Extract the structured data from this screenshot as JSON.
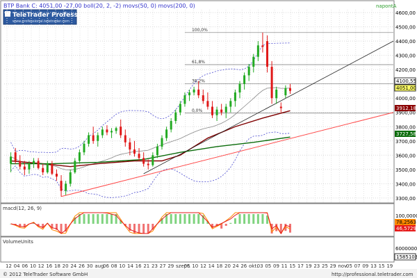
{
  "header": {
    "title": "BTP Bank C: 4051,00 -27,00 boll(20, 2, -2) movs(50, 0) movs(200, 0)",
    "period": "napontA",
    "logo_text": "TeleTrader Professional",
    "logo_url": "www.professional.teletrader.com"
  },
  "price_tags": {
    "last_price_box": "4100,55",
    "last_price": "4051,00",
    "ma50": "3912,18",
    "ma200": "3727,58"
  },
  "fib_labels": [
    "100,0%",
    "61,8%",
    "38,2%",
    "0,0%"
  ],
  "macd": {
    "title": "macd(12, 26, 9)",
    "value_1": "78,2563",
    "value_2": "46,5729",
    "scale_label": "100,0000"
  },
  "volume": {
    "title": "VolumeUnits",
    "scale_label": "6000000",
    "last_value": "1585103"
  },
  "footer": {
    "copyright": "© 2012 TeleTrader Software GmbH",
    "url": "http://professional.teletrader.com"
  },
  "chart_data": {
    "type": "candlestick",
    "y_ticks": [
      "4600,00",
      "4500,00",
      "4400,00",
      "4300,00",
      "4200,00",
      "4100,00",
      "4000,00",
      "3900,00",
      "3800,00",
      "3700,00",
      "3600,00",
      "3500,00",
      "3400,00",
      "3300,00"
    ],
    "ylim": [
      3270,
      4620
    ],
    "x_ticks": [
      "12",
      "04",
      "06",
      "10",
      "12",
      "16",
      "18",
      "20",
      "24",
      "26",
      "30",
      "aug.",
      "06",
      "08",
      "10",
      "14",
      "16",
      "21",
      "23",
      "27",
      "29",
      "szept.",
      "06",
      "10",
      "12",
      "14",
      "18",
      "20",
      "24",
      "26",
      "okt.",
      "03",
      "05",
      "09",
      "11",
      "15",
      "17",
      "19",
      "23",
      "25",
      "29",
      "nov.",
      "05",
      "07",
      "09",
      "13",
      "15",
      "19"
    ],
    "candles": [
      {
        "x": 1,
        "o": 3540,
        "h": 3620,
        "l": 3480,
        "c": 3590
      },
      {
        "x": 2,
        "o": 3620,
        "h": 3650,
        "l": 3540,
        "c": 3560
      },
      {
        "x": 3,
        "o": 3560,
        "h": 3600,
        "l": 3500,
        "c": 3520
      },
      {
        "x": 4,
        "o": 3520,
        "h": 3560,
        "l": 3460,
        "c": 3500
      },
      {
        "x": 5,
        "o": 3500,
        "h": 3560,
        "l": 3470,
        "c": 3540
      },
      {
        "x": 6,
        "o": 3540,
        "h": 3580,
        "l": 3510,
        "c": 3560
      },
      {
        "x": 7,
        "o": 3560,
        "h": 3580,
        "l": 3500,
        "c": 3510
      },
      {
        "x": 8,
        "o": 3510,
        "h": 3540,
        "l": 3460,
        "c": 3480
      },
      {
        "x": 9,
        "o": 3480,
        "h": 3560,
        "l": 3470,
        "c": 3540
      },
      {
        "x": 10,
        "o": 3540,
        "h": 3560,
        "l": 3460,
        "c": 3470
      },
      {
        "x": 11,
        "o": 3470,
        "h": 3500,
        "l": 3420,
        "c": 3450
      },
      {
        "x": 12,
        "o": 3420,
        "h": 3460,
        "l": 3310,
        "c": 3350
      },
      {
        "x": 13,
        "o": 3350,
        "h": 3420,
        "l": 3320,
        "c": 3400
      },
      {
        "x": 14,
        "o": 3400,
        "h": 3500,
        "l": 3380,
        "c": 3480
      },
      {
        "x": 15,
        "o": 3480,
        "h": 3580,
        "l": 3470,
        "c": 3560
      },
      {
        "x": 16,
        "o": 3560,
        "h": 3640,
        "l": 3540,
        "c": 3620
      },
      {
        "x": 17,
        "o": 3620,
        "h": 3700,
        "l": 3600,
        "c": 3680
      },
      {
        "x": 18,
        "o": 3680,
        "h": 3760,
        "l": 3660,
        "c": 3740
      },
      {
        "x": 19,
        "o": 3740,
        "h": 3800,
        "l": 3680,
        "c": 3700
      },
      {
        "x": 20,
        "o": 3700,
        "h": 3760,
        "l": 3660,
        "c": 3740
      },
      {
        "x": 21,
        "o": 3740,
        "h": 3800,
        "l": 3720,
        "c": 3780
      },
      {
        "x": 22,
        "o": 3780,
        "h": 3810,
        "l": 3740,
        "c": 3760
      },
      {
        "x": 23,
        "o": 3760,
        "h": 3790,
        "l": 3720,
        "c": 3770
      },
      {
        "x": 24,
        "o": 3770,
        "h": 3800,
        "l": 3750,
        "c": 3790
      },
      {
        "x": 25,
        "o": 3800,
        "h": 3850,
        "l": 3720,
        "c": 3740
      },
      {
        "x": 26,
        "o": 3740,
        "h": 3780,
        "l": 3660,
        "c": 3690
      },
      {
        "x": 27,
        "o": 3690,
        "h": 3720,
        "l": 3600,
        "c": 3640
      },
      {
        "x": 28,
        "o": 3640,
        "h": 3700,
        "l": 3590,
        "c": 3610
      },
      {
        "x": 29,
        "o": 3610,
        "h": 3650,
        "l": 3560,
        "c": 3580
      },
      {
        "x": 30,
        "o": 3580,
        "h": 3620,
        "l": 3520,
        "c": 3540
      },
      {
        "x": 31,
        "o": 3540,
        "h": 3570,
        "l": 3500,
        "c": 3530
      },
      {
        "x": 32,
        "o": 3530,
        "h": 3620,
        "l": 3520,
        "c": 3600
      },
      {
        "x": 33,
        "o": 3600,
        "h": 3680,
        "l": 3580,
        "c": 3660
      },
      {
        "x": 34,
        "o": 3660,
        "h": 3740,
        "l": 3640,
        "c": 3720
      },
      {
        "x": 35,
        "o": 3720,
        "h": 3800,
        "l": 3700,
        "c": 3780
      },
      {
        "x": 36,
        "o": 3780,
        "h": 3860,
        "l": 3760,
        "c": 3840
      },
      {
        "x": 37,
        "o": 3840,
        "h": 3920,
        "l": 3820,
        "c": 3900
      },
      {
        "x": 38,
        "o": 3900,
        "h": 3980,
        "l": 3880,
        "c": 3960
      },
      {
        "x": 39,
        "o": 3960,
        "h": 4040,
        "l": 3940,
        "c": 4020
      },
      {
        "x": 40,
        "o": 4020,
        "h": 4060,
        "l": 3980,
        "c": 4040
      },
      {
        "x": 41,
        "o": 4040,
        "h": 4080,
        "l": 4020,
        "c": 4060
      },
      {
        "x": 42,
        "o": 4060,
        "h": 4120,
        "l": 4000,
        "c": 4020
      },
      {
        "x": 43,
        "o": 4020,
        "h": 4060,
        "l": 3960,
        "c": 3980
      },
      {
        "x": 44,
        "o": 3980,
        "h": 4040,
        "l": 3920,
        "c": 3940
      },
      {
        "x": 45,
        "o": 3940,
        "h": 3980,
        "l": 3860,
        "c": 3880
      },
      {
        "x": 46,
        "o": 3880,
        "h": 3940,
        "l": 3840,
        "c": 3920
      },
      {
        "x": 47,
        "o": 3920,
        "h": 3960,
        "l": 3880,
        "c": 3900
      },
      {
        "x": 48,
        "o": 3900,
        "h": 3960,
        "l": 3860,
        "c": 3940
      },
      {
        "x": 49,
        "o": 3940,
        "h": 4000,
        "l": 3900,
        "c": 3980
      },
      {
        "x": 50,
        "o": 3980,
        "h": 4060,
        "l": 3940,
        "c": 4040
      },
      {
        "x": 51,
        "o": 4040,
        "h": 4120,
        "l": 4000,
        "c": 4100
      },
      {
        "x": 52,
        "o": 4100,
        "h": 4180,
        "l": 4060,
        "c": 4160
      },
      {
        "x": 53,
        "o": 4160,
        "h": 4240,
        "l": 4120,
        "c": 4220
      },
      {
        "x": 54,
        "o": 4220,
        "h": 4310,
        "l": 4180,
        "c": 4290
      },
      {
        "x": 55,
        "o": 4290,
        "h": 4400,
        "l": 4260,
        "c": 4370
      },
      {
        "x": 56,
        "o": 4370,
        "h": 4460,
        "l": 4320,
        "c": 4360
      },
      {
        "x": 57,
        "o": 4400,
        "h": 4440,
        "l": 4180,
        "c": 4220
      },
      {
        "x": 58,
        "o": 4220,
        "h": 4260,
        "l": 3960,
        "c": 4000
      },
      {
        "x": 59,
        "o": 4000,
        "h": 4080,
        "l": 3960,
        "c": 4060
      },
      {
        "x": 60,
        "o": 3940,
        "h": 3970,
        "l": 3900,
        "c": 3930
      },
      {
        "x": 61,
        "o": 4020,
        "h": 4090,
        "l": 4000,
        "c": 4070
      },
      {
        "x": 62,
        "o": 4070,
        "h": 4100,
        "l": 4030,
        "c": 4051
      }
    ]
  }
}
